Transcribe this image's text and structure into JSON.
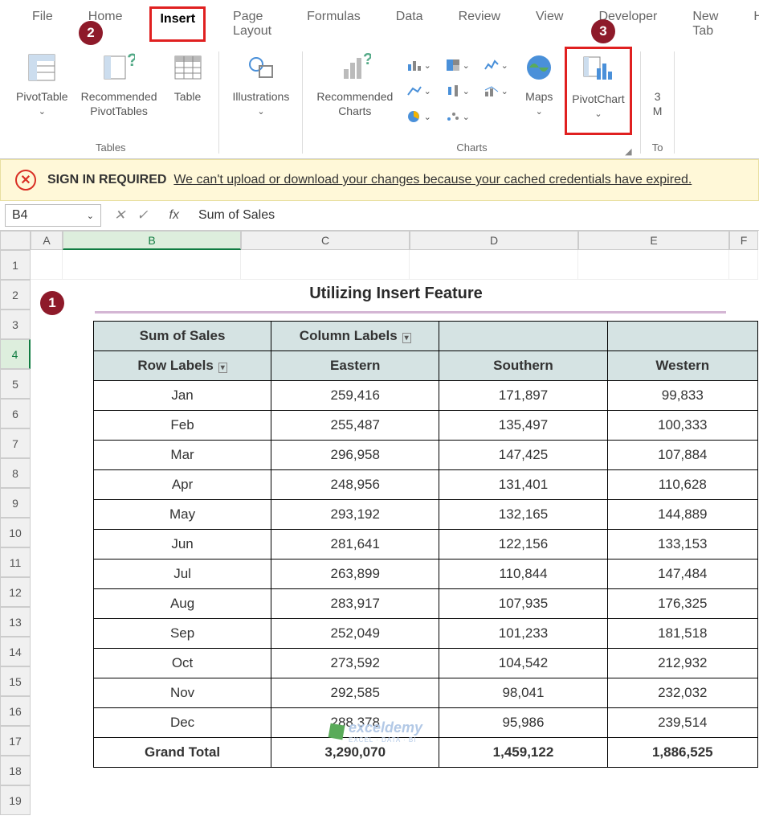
{
  "tabs": [
    "File",
    "Home",
    "Insert",
    "Page Layout",
    "Formulas",
    "Data",
    "Review",
    "View",
    "Developer",
    "New Tab",
    "H"
  ],
  "ribbon": {
    "tables": {
      "label": "Tables",
      "pivot": "PivotTable",
      "rec": "Recommended\nPivotTables",
      "table": "Table"
    },
    "illus": {
      "label": "Illustrations"
    },
    "charts": {
      "label": "Charts",
      "rec": "Recommended\nCharts",
      "maps": "Maps",
      "pivot": "PivotChart"
    },
    "tours": {
      "partial1": "3",
      "partial2": "M",
      "partial3": "To"
    }
  },
  "notes": {
    "n1": "1",
    "n2": "2",
    "n3": "3"
  },
  "warn": {
    "title": "SIGN IN REQUIRED",
    "msg": "We can't upload or download your changes because your cached credentials have expired."
  },
  "fbar": {
    "name": "B4",
    "val": "Sum of Sales"
  },
  "cols": [
    "A",
    "B",
    "C",
    "D",
    "E",
    "F"
  ],
  "rows": [
    "1",
    "2",
    "3",
    "4",
    "5",
    "6",
    "7",
    "8",
    "9",
    "10",
    "11",
    "12",
    "13",
    "14",
    "15",
    "16",
    "17",
    "18",
    "19"
  ],
  "sheet_title": "Utilizing Insert Feature",
  "pivot": {
    "corner": "Sum of Sales",
    "col_label": "Column Labels",
    "row_label": "Row Labels",
    "cols": [
      "Eastern",
      "Southern",
      "Western"
    ],
    "rows": [
      "Jan",
      "Feb",
      "Mar",
      "Apr",
      "May",
      "Jun",
      "Jul",
      "Aug",
      "Sep",
      "Oct",
      "Nov",
      "Dec"
    ],
    "data": [
      [
        "259,416",
        "171,897",
        "99,833"
      ],
      [
        "255,487",
        "135,497",
        "100,333"
      ],
      [
        "296,958",
        "147,425",
        "107,884"
      ],
      [
        "248,956",
        "131,401",
        "110,628"
      ],
      [
        "293,192",
        "132,165",
        "144,889"
      ],
      [
        "281,641",
        "122,156",
        "133,153"
      ],
      [
        "263,899",
        "110,844",
        "147,484"
      ],
      [
        "283,917",
        "107,935",
        "176,325"
      ],
      [
        "252,049",
        "101,233",
        "181,518"
      ],
      [
        "273,592",
        "104,542",
        "212,932"
      ],
      [
        "292,585",
        "98,041",
        "232,032"
      ],
      [
        "288,378",
        "95,986",
        "239,514"
      ]
    ],
    "total_label": "Grand Total",
    "totals": [
      "3,290,070",
      "1,459,122",
      "1,886,525"
    ]
  },
  "watermark": {
    "brand": "exceldemy",
    "tag": "EXCEL · DATA · BI"
  }
}
